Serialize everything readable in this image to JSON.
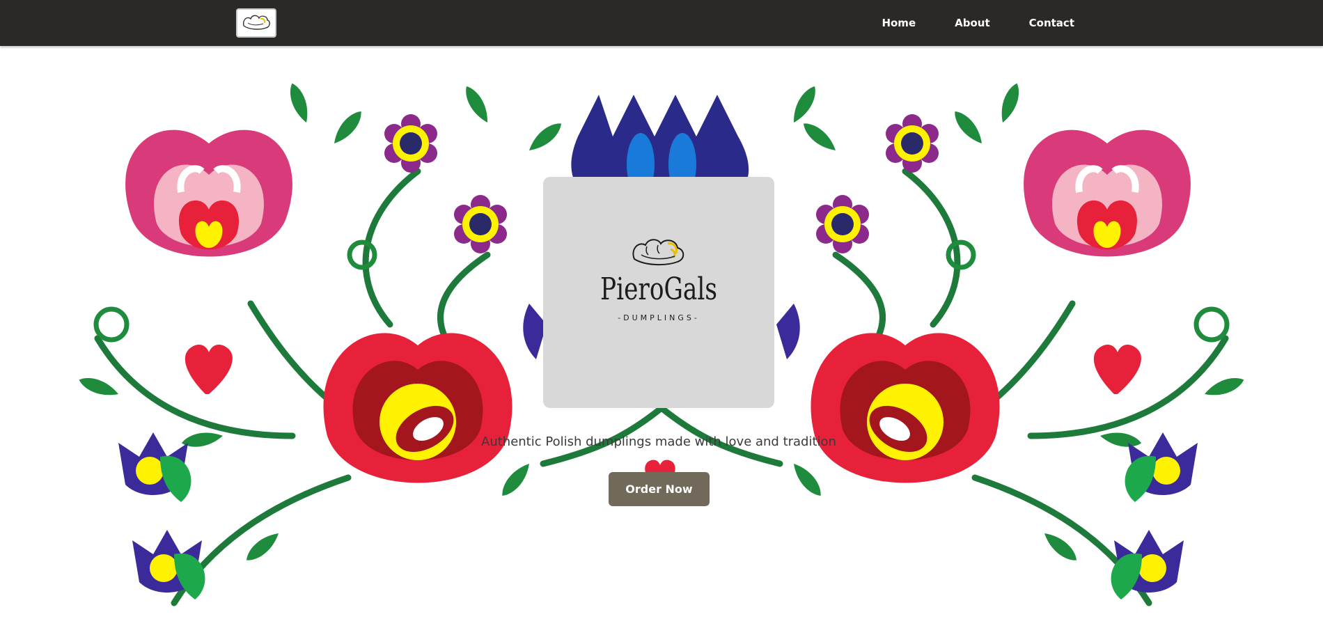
{
  "nav": {
    "logo_icon": "dumpling-logo-icon",
    "links": [
      {
        "label": "Home"
      },
      {
        "label": "About"
      },
      {
        "label": "Contact"
      }
    ]
  },
  "hero": {
    "brand_name": "PieroGals",
    "brand_subtitle": "-DUMPLINGS-",
    "brand_icon": "dumplings-icon",
    "tagline": "Authentic Polish dumplings made with love and tradition",
    "cta_label": "Order Now",
    "background": "polish-folk-floral-pattern"
  },
  "colors": {
    "navbar": "#2b2927",
    "card": "#d8d8d8",
    "button": "#716a5b",
    "pink": "#d93a79",
    "red": "#e8213a",
    "yellow": "#fff200",
    "green": "#1e8c3c",
    "purple": "#8b2a8a",
    "blue": "#3a2a9a"
  }
}
